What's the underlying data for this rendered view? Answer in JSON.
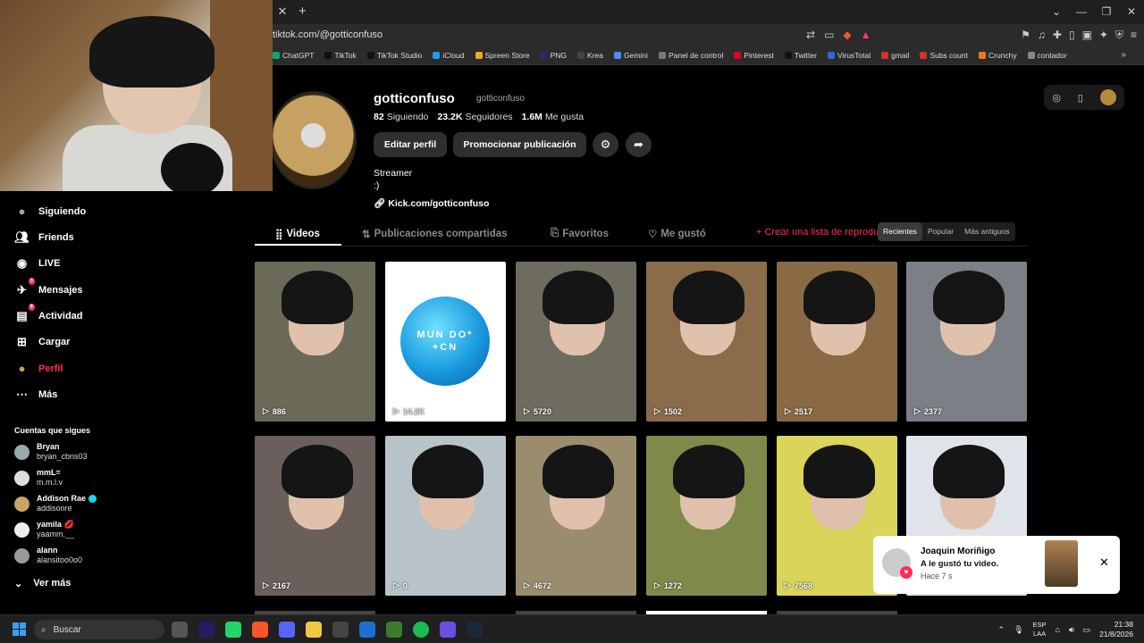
{
  "browser": {
    "url": "tiktok.com/@gotticonfuso",
    "bookmarks": [
      "ChatGPT",
      "TikTok",
      "TikTok Studio",
      "iCloud",
      "Spreen Store",
      "PNG",
      "Krea",
      "Gemini",
      "Panel de control",
      "Pinterest",
      "Twitter",
      "VirusTotal",
      "gmail",
      "Subs count",
      "Crunchy",
      "contador"
    ],
    "bookmark_colors": [
      "#10a37f",
      "#111",
      "#111",
      "#1d9bf0",
      "#f5a623",
      "#2a2a6a",
      "#444",
      "#4b8cf5",
      "#777",
      "#e60023",
      "#111",
      "#3367d6",
      "#d93025",
      "#d93025",
      "#f47521",
      "#888"
    ]
  },
  "nav": {
    "items": [
      {
        "label": "Siguiendo",
        "icon": "following-avatar-icon"
      },
      {
        "label": "Friends",
        "icon": "friends-icon"
      },
      {
        "label": "LIVE",
        "icon": "live-icon"
      },
      {
        "label": "Mensajes",
        "icon": "messages-icon",
        "badge": "3"
      },
      {
        "label": "Actividad",
        "icon": "activity-icon",
        "badge": "9"
      },
      {
        "label": "Cargar",
        "icon": "upload-icon"
      },
      {
        "label": "Perfil",
        "icon": "profile-avatar-icon"
      },
      {
        "label": "Más",
        "icon": "more-icon"
      }
    ],
    "following_title": "Cuentas que sigues",
    "following": [
      {
        "name": "Bryan",
        "handle": "bryan_cbns03",
        "color": "#9aa"
      },
      {
        "name": "mmL=",
        "handle": "m.m.l.v",
        "color": "#ddd"
      },
      {
        "name": "Addison Rae",
        "handle": "addisonre",
        "color": "#c9a36a",
        "verified": true
      },
      {
        "name": "yamila 💋",
        "handle": "yaamm.__",
        "color": "#eee"
      },
      {
        "name": "alann",
        "handle": "alansitoo0o0",
        "color": "#999"
      }
    ],
    "see_more": "Ver más"
  },
  "profile": {
    "username": "gotticonfuso",
    "nickname": "gotticonfuso",
    "following_count": "82",
    "following_label": "Siguiendo",
    "followers_count": "23.2K",
    "followers_label": "Seguidores",
    "likes_count": "1.6M",
    "likes_label": "Me gusta",
    "edit_button": "Editar perfil",
    "promote_button": "Promocionar publicación",
    "bio_line1": "Streamer",
    "bio_line2": ":)",
    "link": "Kick.com/gotticonfuso"
  },
  "tabs": {
    "videos": "Videos",
    "reposts": "Publicaciones compartidas",
    "favorites": "Favoritos",
    "liked": "Me gustó",
    "create_list": "+ Crear una lista de reproducción",
    "sort": [
      "Recientes",
      "Popular",
      "Más antiguos"
    ],
    "sort_selected": "Recientes"
  },
  "videos": [
    {
      "views": "886",
      "bg": "#6b6a58"
    },
    {
      "views": "14.2K",
      "bg": "#ffffff",
      "globe": "MUN DO* +CN"
    },
    {
      "views": "5720",
      "bg": "#6e6c5e"
    },
    {
      "views": "1502",
      "bg": "#8a6b4a"
    },
    {
      "views": "2517",
      "bg": "#8a6a45"
    },
    {
      "views": "2377",
      "bg": "#7b7f86"
    },
    {
      "views": "2167",
      "bg": "#6a5f5a"
    },
    {
      "views": "0",
      "bg": "#b7c3c9"
    },
    {
      "views": "4672",
      "bg": "#9a8d6e"
    },
    {
      "views": "1272",
      "bg": "#7f8a4a"
    },
    {
      "views": "7568",
      "bg": "#d9d45a"
    },
    {
      "views": "",
      "bg": "#e0e4ea"
    }
  ],
  "notification": {
    "name": "Joaquin Moriñigo",
    "text": "A le gustó tu video.",
    "time": "Hace 7 s"
  },
  "taskbar": {
    "search_placeholder": "Buscar",
    "lang_top": "ESP",
    "lang_bottom": "LAA",
    "time": "21:38",
    "date": "21/8/2026"
  }
}
